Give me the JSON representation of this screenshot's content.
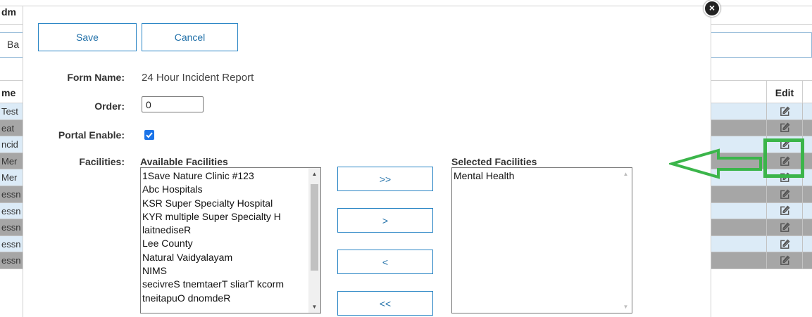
{
  "background": {
    "title": "dm",
    "tab_label": "Ba",
    "name_header": "me",
    "edit_header": "Edit",
    "rows": [
      {
        "name": "Test",
        "shade": "light"
      },
      {
        "name": "eat",
        "shade": "dark"
      },
      {
        "name": "ncid",
        "shade": "light"
      },
      {
        "name": "Mer",
        "shade": "dark"
      },
      {
        "name": "Mer",
        "shade": "light"
      },
      {
        "name": "essn",
        "shade": "dark"
      },
      {
        "name": "essn",
        "shade": "light"
      },
      {
        "name": "essn",
        "shade": "dark"
      },
      {
        "name": "essn",
        "shade": "light"
      },
      {
        "name": "essn",
        "shade": "dark"
      }
    ]
  },
  "modal": {
    "save_label": "Save",
    "cancel_label": "Cancel",
    "close_icon": "×",
    "form_name_label": "Form Name:",
    "form_name_value": "24 Hour Incident Report",
    "order_label": "Order:",
    "order_value": "0",
    "portal_label": "Portal Enable:",
    "portal_enabled": true,
    "facilities_label": "Facilities:",
    "available_title": "Available Facilities",
    "selected_title": "Selected Facilities",
    "available": [
      "1Save Nature Clinic #123",
      "Abc Hospitals",
      "KSR Super Specialty Hospital",
      "KYR multiple Super Specialty H",
      "laitnediseR",
      "Lee County",
      "Natural Vaidyalayam",
      "NIMS",
      "secivreS tnemtaerT sliarT kcorm",
      "tneitapuO dnomdeR"
    ],
    "selected": [
      "Mental Health"
    ],
    "btn_add_all": ">>",
    "btn_add": ">",
    "btn_remove": "<",
    "btn_remove_all": "<<"
  },
  "annotation": {
    "color": "#3bb54a"
  }
}
